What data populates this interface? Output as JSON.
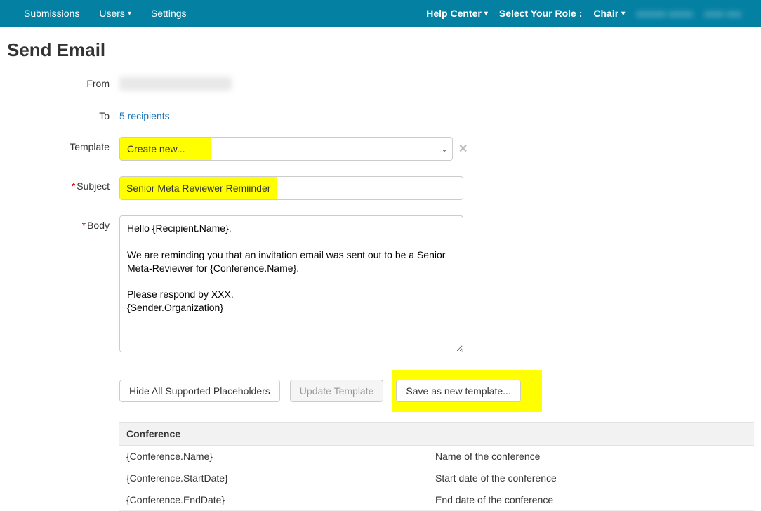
{
  "nav": {
    "left": [
      {
        "label": "Submissions",
        "caret": false
      },
      {
        "label": "Users",
        "caret": true
      },
      {
        "label": "Settings",
        "caret": false
      }
    ],
    "right": {
      "help": "Help Center",
      "role_label": "Select Your Role :",
      "role_value": "Chair",
      "blur1": "xxxxxx xxxxx",
      "blur2": "xxxx xxx"
    }
  },
  "title": "Send Email",
  "labels": {
    "from": "From",
    "to": "To",
    "template": "Template",
    "subject": "Subject",
    "body": "Body"
  },
  "form": {
    "from_hidden": "(redacted)",
    "to_text": "5 recipients",
    "template_text": "Create new...",
    "subject": "Senior Meta Reviewer Remiinder",
    "body": "Hello {Recipient.Name},\n\nWe are reminding you that an invitation email was sent out to be a Senior Meta-Reviewer for {Conference.Name}.\n\nPlease respond by XXX.\n{Sender.Organization}"
  },
  "buttons": {
    "hide": "Hide All Supported Placeholders",
    "update": "Update Template",
    "save": "Save as new template..."
  },
  "placeholders": {
    "section": "Conference",
    "rows": [
      {
        "key": "{Conference.Name}",
        "desc": "Name of the conference"
      },
      {
        "key": "{Conference.StartDate}",
        "desc": "Start date of the conference"
      },
      {
        "key": "{Conference.EndDate}",
        "desc": "End date of the conference"
      }
    ]
  }
}
